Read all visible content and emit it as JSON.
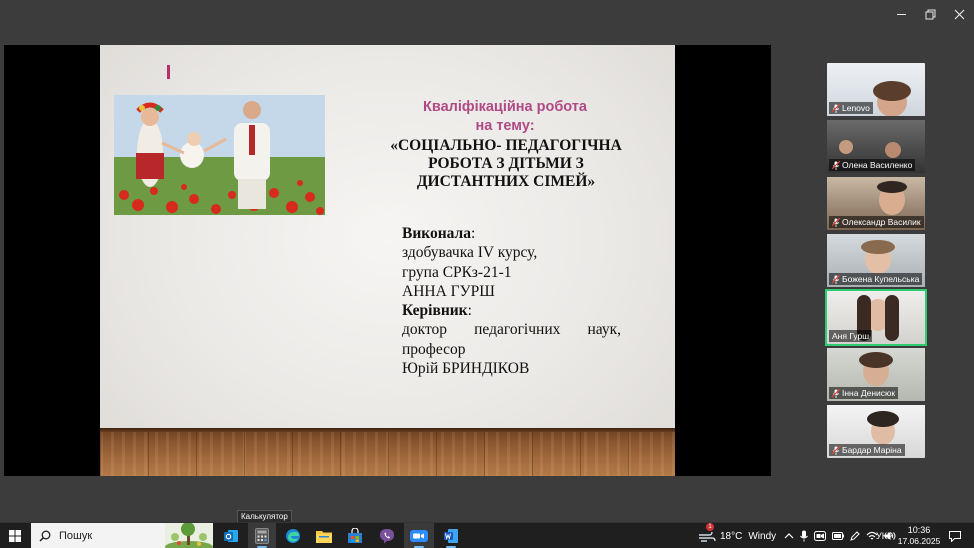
{
  "slide": {
    "title_line1": "Кваліфікаційна робота",
    "title_line2": "на тему:",
    "topic_line1": "«СОЦІАЛЬНО- ПЕДАГОГІЧНА",
    "topic_line2": "РОБОТА З ДІТЬМИ З",
    "topic_line3": "ДИСТАНТНИХ СІМЕЙ»",
    "author_heading": "Виконала",
    "author_colon": ":",
    "author_line1": "здобувачка IV курсу,",
    "author_line2": "група СРКз-21-1",
    "author_name": "АННА ГУРШ",
    "supervisor_heading": "Керівник",
    "supervisor_colon": ":",
    "supervisor_line1_a": "доктор",
    "supervisor_line1_b": "педагогічних",
    "supervisor_line1_c": "наук,",
    "supervisor_line2": "професор",
    "supervisor_name": "Юрій БРИНДІКОВ",
    "colors": {
      "title": "#b04a86",
      "mark": "#b4326a"
    }
  },
  "participants": [
    {
      "name": "Lenovo",
      "muted": true,
      "active": false,
      "bg": "#d8dde3"
    },
    {
      "name": "Олена Василенко",
      "muted": true,
      "active": false,
      "bg": "#4a4a4a"
    },
    {
      "name": "Олександр Василик",
      "muted": true,
      "active": false,
      "bg": "#8a6f55"
    },
    {
      "name": "Божена Купельська",
      "muted": true,
      "active": false,
      "bg": "#bfc4c8"
    },
    {
      "name": "Аня Гурш",
      "muted": false,
      "active": true,
      "bg": "#e3e3e1"
    },
    {
      "name": "Інна Денисюк",
      "muted": true,
      "active": false,
      "bg": "#c9ccc6"
    },
    {
      "name": "Бардар Маріна",
      "muted": true,
      "active": false,
      "bg": "#e8e8e8"
    }
  ],
  "taskbar": {
    "search_placeholder": "Пошук",
    "tooltip": "Калькулятор",
    "weather_temp": "18°C",
    "weather_text": "Windy",
    "weather_badge": "1",
    "language": "УКР",
    "time": "10:36",
    "date": "17.06.2025",
    "apps": [
      "outlook-icon",
      "calculator-icon",
      "edge-icon",
      "file-explorer-icon",
      "store-icon",
      "viber-icon",
      "zoom-icon",
      "word-icon"
    ]
  }
}
